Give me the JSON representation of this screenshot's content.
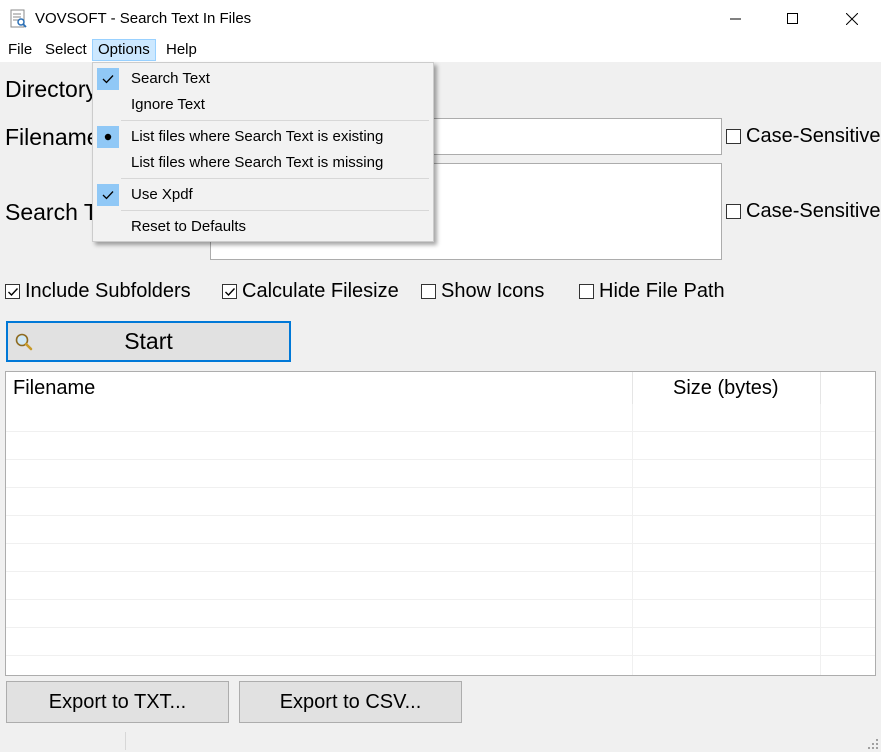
{
  "window": {
    "title": "VOVSOFT - Search Text In Files"
  },
  "menubar": {
    "file": "File",
    "select": "Select",
    "options": "Options",
    "help": "Help"
  },
  "form": {
    "directory_label": "Directory",
    "filename_label": "Filename",
    "search_label": "Search T",
    "case_sensitive_1": "Case-Sensitive",
    "case_sensitive_2": "Case-Sensitive"
  },
  "options_row": {
    "include_subfolders": {
      "label": "Include Subfolders",
      "checked": true
    },
    "calculate_filesize": {
      "label": "Calculate Filesize",
      "checked": true
    },
    "show_icons": {
      "label": "Show Icons",
      "checked": false
    },
    "hide_file_path": {
      "label": "Hide File Path",
      "checked": false
    }
  },
  "start_button": "Start",
  "results": {
    "columns": [
      "Filename",
      "Size (bytes)"
    ],
    "rows": []
  },
  "bottom": {
    "export_txt": "Export to TXT...",
    "export_csv": "Export to CSV..."
  },
  "options_menu": {
    "search_text": "Search Text",
    "ignore_text": "Ignore Text",
    "list_existing": "List files where Search Text is existing",
    "list_missing": "List files where Search Text is missing",
    "use_xpdf": "Use Xpdf",
    "reset": "Reset to Defaults"
  },
  "colors": {
    "accent": "#0078d7",
    "menu_highlight": "#cce8ff",
    "check_bg": "#90c8f6"
  }
}
